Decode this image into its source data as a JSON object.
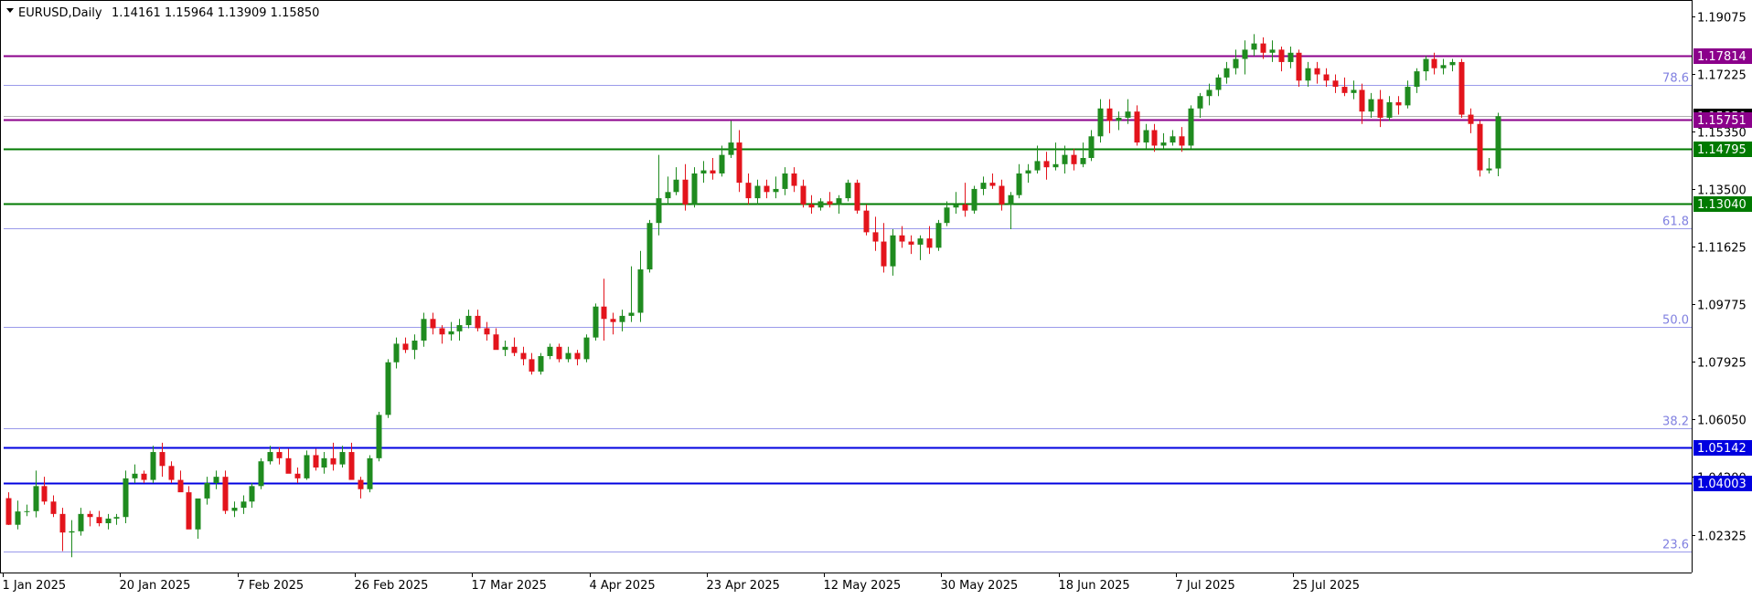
{
  "header": {
    "collapse_icon": "triangle-down-icon",
    "symbol": "EURUSD,Daily",
    "ohlc": "1.14161 1.15964 1.13909 1.15850"
  },
  "colors": {
    "bull": "#1f8b1f",
    "bear": "#e3141c",
    "purple_line": "#8b008b",
    "green_line": "#007a00",
    "blue_line": "#0000e0",
    "fib_line": "#9a9aea",
    "fib_text": "#8080e0",
    "axis": "#000000",
    "current_price_line": "#b0b0b0"
  },
  "chart_data": {
    "type": "candlestick",
    "symbol": "EURUSD",
    "timeframe": "Daily",
    "ylim": [
      1.0155,
      1.1925
    ],
    "y_ticks": [
      "1.19075",
      "1.17225",
      "1.15350",
      "1.13500",
      "1.11625",
      "1.09775",
      "1.07925",
      "1.06050",
      "1.04200",
      "1.02325"
    ],
    "x_ticks": [
      "1 Jan 2025",
      "20 Jan 2025",
      "7 Feb 2025",
      "26 Feb 2025",
      "17 Mar 2025",
      "4 Apr 2025",
      "23 Apr 2025",
      "12 May 2025",
      "30 May 2025",
      "18 Jun 2025",
      "7 Jul 2025",
      "25 Jul 2025"
    ],
    "x_tick_index": [
      0,
      13,
      26,
      39,
      52,
      65,
      78,
      91,
      104,
      117,
      130,
      143
    ],
    "grid": false,
    "horizontal_levels": [
      {
        "price": 1.17814,
        "label": "1.17814",
        "color": "#8b008b"
      },
      {
        "price": 1.15751,
        "label": "1.15751",
        "color": "#8b008b"
      },
      {
        "price": 1.14795,
        "label": "1.14795",
        "color": "#007a00"
      },
      {
        "price": 1.1304,
        "label": "1.13040",
        "color": "#007a00"
      },
      {
        "price": 1.05142,
        "label": "1.05142",
        "color": "#0000e0"
      },
      {
        "price": 1.04003,
        "label": "1.04003",
        "color": "#0000e0"
      }
    ],
    "fibonacci": [
      {
        "level": "78.6",
        "price": 1.1685
      },
      {
        "level": "61.8",
        "price": 1.1222
      },
      {
        "level": "50.0",
        "price": 1.0903
      },
      {
        "level": "38.2",
        "price": 1.0578
      },
      {
        "level": "23.6",
        "price": 1.0178
      }
    ],
    "current_price": 1.1585,
    "ohlc": [
      [
        1.0351,
        1.037,
        1.0264,
        1.0265
      ],
      [
        1.0265,
        1.0343,
        1.025,
        1.0308
      ],
      [
        1.0308,
        1.033,
        1.0293,
        1.0309
      ],
      [
        1.0309,
        1.044,
        1.0289,
        1.039
      ],
      [
        1.039,
        1.042,
        1.033,
        1.034
      ],
      [
        1.034,
        1.036,
        1.029,
        1.03
      ],
      [
        1.03,
        1.032,
        1.018,
        1.024
      ],
      [
        1.024,
        1.028,
        1.016,
        1.0244
      ],
      [
        1.0244,
        1.032,
        1.023,
        1.03
      ],
      [
        1.03,
        1.031,
        1.026,
        1.029
      ],
      [
        1.029,
        1.031,
        1.026,
        1.027
      ],
      [
        1.027,
        1.03,
        1.025,
        1.0285
      ],
      [
        1.0285,
        1.03,
        1.0265,
        1.029
      ],
      [
        1.029,
        1.044,
        1.027,
        1.0415
      ],
      [
        1.0415,
        1.046,
        1.04,
        1.043
      ],
      [
        1.043,
        1.044,
        1.04,
        1.041
      ],
      [
        1.041,
        1.052,
        1.04,
        1.05
      ],
      [
        1.05,
        1.053,
        1.042,
        1.0455
      ],
      [
        1.0455,
        1.047,
        1.04,
        1.041
      ],
      [
        1.041,
        1.044,
        1.038,
        1.037
      ],
      [
        1.037,
        1.039,
        1.026,
        1.025
      ],
      [
        1.025,
        1.031,
        1.022,
        1.035
      ],
      [
        1.035,
        1.042,
        1.033,
        1.04
      ],
      [
        1.04,
        1.044,
        1.038,
        1.042
      ],
      [
        1.042,
        1.044,
        1.03,
        1.031
      ],
      [
        1.031,
        1.034,
        1.029,
        1.032
      ],
      [
        1.032,
        1.036,
        1.03,
        1.034
      ],
      [
        1.034,
        1.04,
        1.032,
        1.039
      ],
      [
        1.039,
        1.048,
        1.038,
        1.047
      ],
      [
        1.047,
        1.052,
        1.046,
        1.05
      ],
      [
        1.05,
        1.0515,
        1.046,
        1.048
      ],
      [
        1.048,
        1.051,
        1.044,
        1.043
      ],
      [
        1.043,
        1.045,
        1.04,
        1.0415
      ],
      [
        1.0415,
        1.0505,
        1.041,
        1.049
      ],
      [
        1.049,
        1.051,
        1.044,
        1.045
      ],
      [
        1.045,
        1.05,
        1.043,
        1.048
      ],
      [
        1.048,
        1.053,
        1.044,
        1.046
      ],
      [
        1.046,
        1.052,
        1.045,
        1.05
      ],
      [
        1.05,
        1.053,
        1.042,
        1.041
      ],
      [
        1.041,
        1.042,
        1.035,
        1.038
      ],
      [
        1.038,
        1.049,
        1.037,
        1.048
      ],
      [
        1.048,
        1.063,
        1.047,
        1.062
      ],
      [
        1.062,
        1.08,
        1.061,
        1.079
      ],
      [
        1.079,
        1.087,
        1.077,
        1.085
      ],
      [
        1.085,
        1.087,
        1.082,
        1.083
      ],
      [
        1.083,
        1.088,
        1.08,
        1.086
      ],
      [
        1.086,
        1.095,
        1.084,
        1.093
      ],
      [
        1.093,
        1.095,
        1.088,
        1.09
      ],
      [
        1.09,
        1.091,
        1.085,
        1.088
      ],
      [
        1.088,
        1.092,
        1.086,
        1.089
      ],
      [
        1.089,
        1.093,
        1.086,
        1.091
      ],
      [
        1.091,
        1.096,
        1.09,
        1.094
      ],
      [
        1.094,
        1.096,
        1.089,
        1.09
      ],
      [
        1.09,
        1.092,
        1.086,
        1.088
      ],
      [
        1.088,
        1.09,
        1.085,
        1.083
      ],
      [
        1.083,
        1.086,
        1.081,
        1.084
      ],
      [
        1.084,
        1.087,
        1.081,
        1.082
      ],
      [
        1.082,
        1.084,
        1.078,
        1.08
      ],
      [
        1.08,
        1.082,
        1.075,
        1.076
      ],
      [
        1.076,
        1.082,
        1.075,
        1.081
      ],
      [
        1.081,
        1.085,
        1.08,
        1.084
      ],
      [
        1.084,
        1.085,
        1.079,
        1.08
      ],
      [
        1.08,
        1.084,
        1.079,
        1.082
      ],
      [
        1.082,
        1.083,
        1.078,
        1.08
      ],
      [
        1.08,
        1.088,
        1.079,
        1.087
      ],
      [
        1.087,
        1.098,
        1.086,
        1.097
      ],
      [
        1.097,
        1.106,
        1.086,
        1.093
      ],
      [
        1.093,
        1.095,
        1.088,
        1.092
      ],
      [
        1.092,
        1.096,
        1.089,
        1.094
      ],
      [
        1.094,
        1.11,
        1.092,
        1.095
      ],
      [
        1.095,
        1.115,
        1.092,
        1.109
      ],
      [
        1.109,
        1.125,
        1.108,
        1.124
      ],
      [
        1.124,
        1.146,
        1.12,
        1.132
      ],
      [
        1.132,
        1.139,
        1.13,
        1.134
      ],
      [
        1.134,
        1.142,
        1.133,
        1.138
      ],
      [
        1.138,
        1.143,
        1.128,
        1.13
      ],
      [
        1.13,
        1.142,
        1.129,
        1.14
      ],
      [
        1.14,
        1.144,
        1.137,
        1.141
      ],
      [
        1.141,
        1.145,
        1.138,
        1.14
      ],
      [
        1.14,
        1.149,
        1.139,
        1.146
      ],
      [
        1.146,
        1.157,
        1.145,
        1.15
      ],
      [
        1.15,
        1.154,
        1.134,
        1.137
      ],
      [
        1.137,
        1.14,
        1.13,
        1.132
      ],
      [
        1.132,
        1.138,
        1.13,
        1.136
      ],
      [
        1.136,
        1.138,
        1.132,
        1.134
      ],
      [
        1.134,
        1.139,
        1.132,
        1.135
      ],
      [
        1.135,
        1.142,
        1.133,
        1.14
      ],
      [
        1.14,
        1.142,
        1.134,
        1.136
      ],
      [
        1.136,
        1.138,
        1.129,
        1.13
      ],
      [
        1.13,
        1.133,
        1.127,
        1.129
      ],
      [
        1.129,
        1.132,
        1.128,
        1.131
      ],
      [
        1.131,
        1.134,
        1.129,
        1.13
      ],
      [
        1.13,
        1.133,
        1.127,
        1.132
      ],
      [
        1.132,
        1.138,
        1.131,
        1.137
      ],
      [
        1.137,
        1.138,
        1.127,
        1.128
      ],
      [
        1.128,
        1.13,
        1.12,
        1.121
      ],
      [
        1.121,
        1.126,
        1.115,
        1.118
      ],
      [
        1.118,
        1.124,
        1.108,
        1.11
      ],
      [
        1.11,
        1.122,
        1.107,
        1.12
      ],
      [
        1.12,
        1.123,
        1.116,
        1.118
      ],
      [
        1.118,
        1.12,
        1.114,
        1.117
      ],
      [
        1.117,
        1.12,
        1.112,
        1.119
      ],
      [
        1.119,
        1.123,
        1.114,
        1.116
      ],
      [
        1.116,
        1.125,
        1.115,
        1.124
      ],
      [
        1.124,
        1.131,
        1.123,
        1.129
      ],
      [
        1.129,
        1.134,
        1.127,
        1.13
      ],
      [
        1.13,
        1.137,
        1.126,
        1.128
      ],
      [
        1.128,
        1.136,
        1.127,
        1.135
      ],
      [
        1.135,
        1.139,
        1.133,
        1.137
      ],
      [
        1.137,
        1.14,
        1.135,
        1.136
      ],
      [
        1.136,
        1.138,
        1.128,
        1.13
      ],
      [
        1.13,
        1.134,
        1.122,
        1.133
      ],
      [
        1.133,
        1.143,
        1.132,
        1.14
      ],
      [
        1.14,
        1.143,
        1.137,
        1.141
      ],
      [
        1.141,
        1.149,
        1.14,
        1.144
      ],
      [
        1.144,
        1.147,
        1.138,
        1.142
      ],
      [
        1.142,
        1.15,
        1.141,
        1.143
      ],
      [
        1.143,
        1.149,
        1.14,
        1.146
      ],
      [
        1.146,
        1.148,
        1.141,
        1.143
      ],
      [
        1.143,
        1.15,
        1.142,
        1.145
      ],
      [
        1.145,
        1.154,
        1.144,
        1.152
      ],
      [
        1.152,
        1.164,
        1.15,
        1.161
      ],
      [
        1.161,
        1.164,
        1.153,
        1.157
      ],
      [
        1.157,
        1.16,
        1.154,
        1.158
      ],
      [
        1.158,
        1.164,
        1.156,
        1.16
      ],
      [
        1.16,
        1.162,
        1.149,
        1.15
      ],
      [
        1.15,
        1.156,
        1.148,
        1.154
      ],
      [
        1.154,
        1.156,
        1.147,
        1.149
      ],
      [
        1.149,
        1.153,
        1.148,
        1.15
      ],
      [
        1.15,
        1.154,
        1.149,
        1.152
      ],
      [
        1.152,
        1.155,
        1.147,
        1.149
      ],
      [
        1.149,
        1.162,
        1.148,
        1.161
      ],
      [
        1.161,
        1.166,
        1.158,
        1.165
      ],
      [
        1.165,
        1.169,
        1.162,
        1.167
      ],
      [
        1.167,
        1.172,
        1.165,
        1.171
      ],
      [
        1.171,
        1.176,
        1.169,
        1.174
      ],
      [
        1.174,
        1.18,
        1.172,
        1.177
      ],
      [
        1.177,
        1.183,
        1.172,
        1.18
      ],
      [
        1.18,
        1.185,
        1.178,
        1.182
      ],
      [
        1.182,
        1.184,
        1.177,
        1.179
      ],
      [
        1.179,
        1.183,
        1.176,
        1.18
      ],
      [
        1.18,
        1.181,
        1.173,
        1.176
      ],
      [
        1.176,
        1.181,
        1.174,
        1.179
      ],
      [
        1.179,
        1.18,
        1.168,
        1.17
      ],
      [
        1.17,
        1.176,
        1.168,
        1.174
      ],
      [
        1.174,
        1.176,
        1.169,
        1.172
      ],
      [
        1.172,
        1.174,
        1.168,
        1.17
      ],
      [
        1.17,
        1.172,
        1.166,
        1.168
      ],
      [
        1.168,
        1.171,
        1.165,
        1.166
      ],
      [
        1.166,
        1.17,
        1.164,
        1.167
      ],
      [
        1.167,
        1.169,
        1.156,
        1.16
      ],
      [
        1.16,
        1.166,
        1.158,
        1.164
      ],
      [
        1.164,
        1.167,
        1.155,
        1.158
      ],
      [
        1.158,
        1.165,
        1.157,
        1.163
      ],
      [
        1.163,
        1.165,
        1.159,
        1.162
      ],
      [
        1.162,
        1.17,
        1.161,
        1.168
      ],
      [
        1.168,
        1.174,
        1.166,
        1.173
      ],
      [
        1.173,
        1.178,
        1.17,
        1.177
      ],
      [
        1.177,
        1.179,
        1.172,
        1.174
      ],
      [
        1.174,
        1.177,
        1.172,
        1.175
      ],
      [
        1.175,
        1.177,
        1.173,
        1.176
      ],
      [
        1.176,
        1.177,
        1.158,
        1.159
      ],
      [
        1.159,
        1.161,
        1.153,
        1.156
      ],
      [
        1.156,
        1.157,
        1.139,
        1.141
      ],
      [
        1.141,
        1.145,
        1.14,
        1.1416
      ],
      [
        1.1416,
        1.1596,
        1.1391,
        1.1585
      ]
    ]
  }
}
